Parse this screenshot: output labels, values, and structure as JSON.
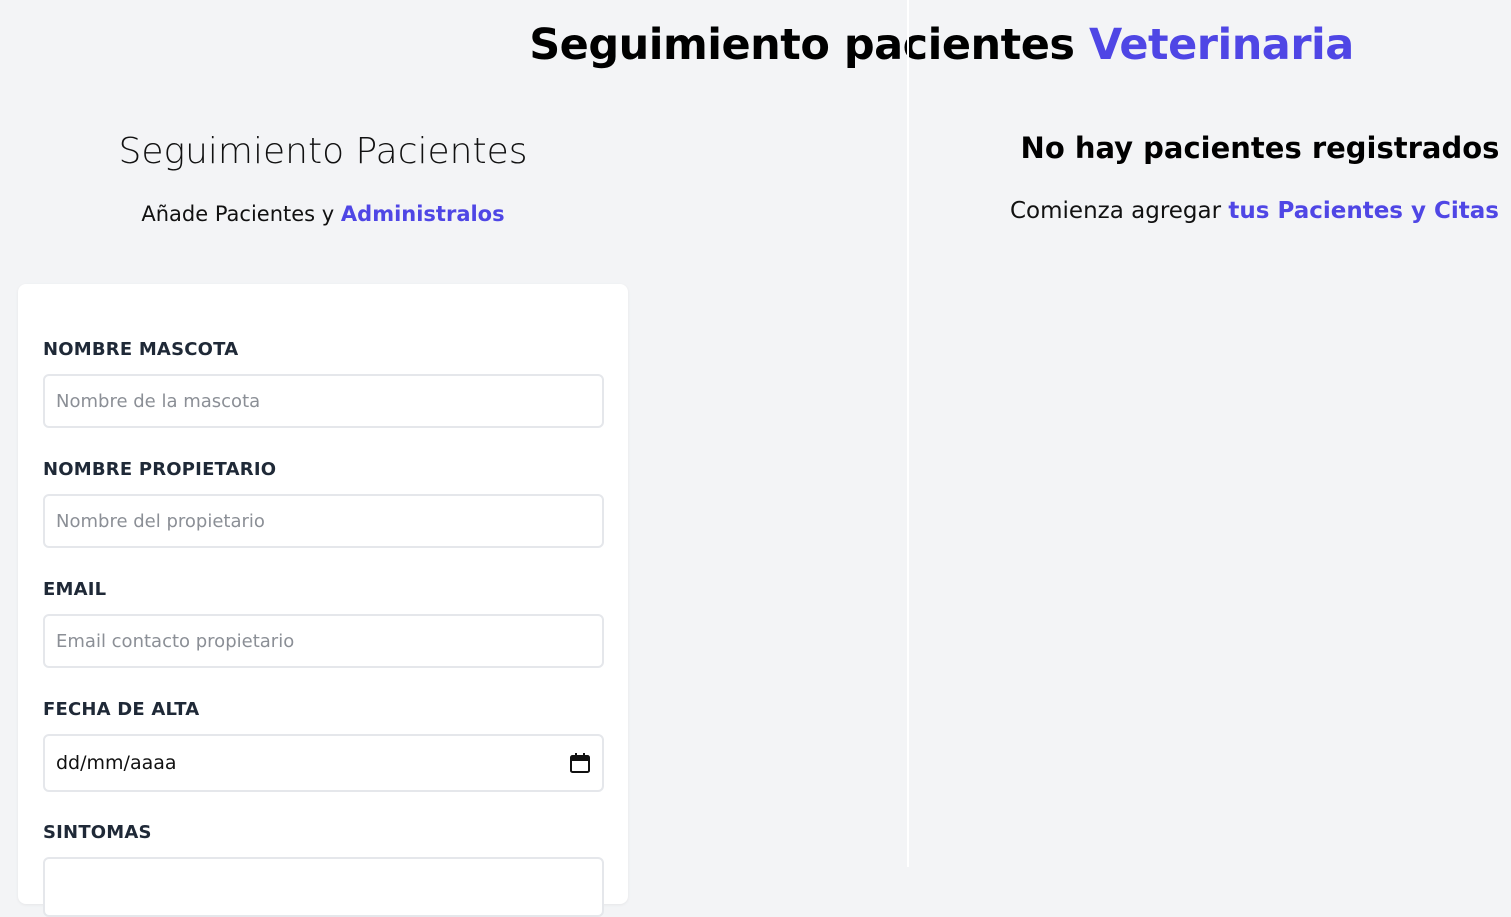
{
  "header": {
    "title_main": "Seguimiento pacientes ",
    "title_accent": "Veterinaria"
  },
  "form_panel": {
    "heading": "Seguimiento Pacientes",
    "subtitle_main": "Añade Pacientes y ",
    "subtitle_accent": "Administralos",
    "fields": {
      "pet_name": {
        "label": "NOMBRE MASCOTA",
        "placeholder": "Nombre de la mascota"
      },
      "owner_name": {
        "label": "NOMBRE PROPIETARIO",
        "placeholder": "Nombre del propietario"
      },
      "email": {
        "label": "EMAIL",
        "placeholder": "Email contacto propietario"
      },
      "discharge_date": {
        "label": "FECHA DE ALTA",
        "value": "dd/mm/aaaa"
      },
      "symptoms": {
        "label": "SINTOMAS"
      }
    }
  },
  "patients_panel": {
    "heading": "No hay pacientes registrados",
    "subtitle_main": "Comienza agregar ",
    "subtitle_accent": "tus Pacientes y Citas"
  },
  "colors": {
    "accent": "#4f46e5",
    "background": "#f3f4f6",
    "card": "#ffffff",
    "label": "#1f2937"
  },
  "icons": {
    "date_picker": "calendar-icon"
  }
}
